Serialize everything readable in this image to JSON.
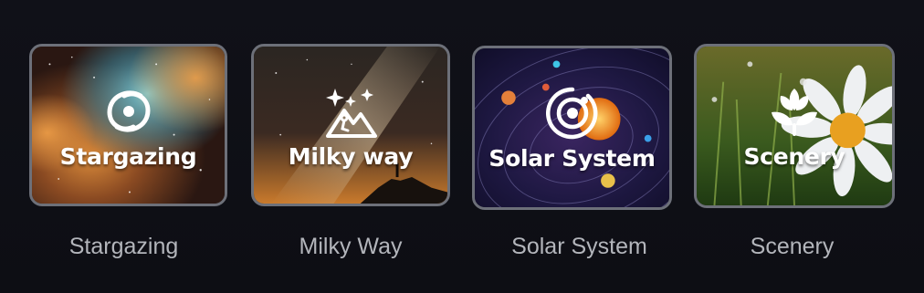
{
  "scenes": [
    {
      "id": "stargazing",
      "tile_title": "Stargazing",
      "caption": "Stargazing",
      "icon": "galaxy-icon"
    },
    {
      "id": "milky-way",
      "tile_title": "Milky way",
      "caption": "Milky Way",
      "icon": "stars-mountain-icon"
    },
    {
      "id": "solar-system",
      "tile_title": "Solar System",
      "caption": "Solar System",
      "icon": "orbit-icon"
    },
    {
      "id": "scenery",
      "tile_title": "Scenery",
      "caption": "Scenery",
      "icon": "flower-icon"
    }
  ],
  "colors": {
    "background": "#0f1016",
    "tile_border": "#6d7079",
    "caption_text": "#b3b5bb",
    "title_text": "#ffffff"
  }
}
